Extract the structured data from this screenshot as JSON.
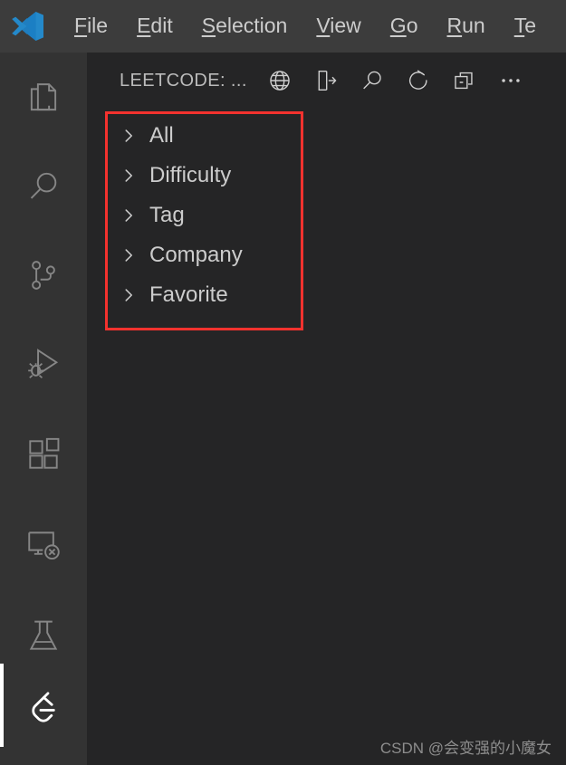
{
  "window": {
    "app_logo_icon": "vscode-logo-icon",
    "titlebar_bg": "#3c3c3c"
  },
  "menubar": {
    "items": [
      {
        "label": "File",
        "mnemonic": "F",
        "rest": "ile"
      },
      {
        "label": "Edit",
        "mnemonic": "E",
        "rest": "dit"
      },
      {
        "label": "Selection",
        "mnemonic": "S",
        "rest": "election"
      },
      {
        "label": "View",
        "mnemonic": "V",
        "rest": "iew"
      },
      {
        "label": "Go",
        "mnemonic": "G",
        "rest": "o"
      },
      {
        "label": "Run",
        "mnemonic": "R",
        "rest": "un"
      },
      {
        "label": "Te",
        "mnemonic": "T",
        "rest": "e"
      }
    ]
  },
  "activitybar": {
    "bg": "#333333",
    "active_indicator_color": "#ffffff",
    "items": [
      {
        "name": "explorer",
        "icon": "files-icon",
        "title": "Explorer",
        "active": false
      },
      {
        "name": "search",
        "icon": "search-icon",
        "title": "Search",
        "active": false
      },
      {
        "name": "source-control",
        "icon": "source-control-icon",
        "title": "Source Control",
        "active": false
      },
      {
        "name": "run-and-debug",
        "icon": "run-and-debug-icon",
        "title": "Run and Debug",
        "active": false
      },
      {
        "name": "extensions",
        "icon": "extensions-icon",
        "title": "Extensions",
        "active": false
      },
      {
        "name": "remote-explorer",
        "icon": "remote-explorer-icon",
        "title": "Remote Explorer",
        "active": false
      },
      {
        "name": "testing",
        "icon": "beaker-icon",
        "title": "Testing",
        "active": false
      },
      {
        "name": "leetcode",
        "icon": "leetcode-icon",
        "title": "LeetCode",
        "active": true
      }
    ]
  },
  "sidebar": {
    "bg": "#252526",
    "header": {
      "title": "LEETCODE: ...",
      "actions": [
        {
          "name": "switch-endpoint",
          "icon": "globe-icon",
          "label": "Switch Endpoint"
        },
        {
          "name": "sign-out",
          "icon": "sign-out-icon",
          "label": "Sign Out"
        },
        {
          "name": "search-problem",
          "icon": "search-icon",
          "label": "Search Problem"
        },
        {
          "name": "refresh",
          "icon": "refresh-icon",
          "label": "Refresh"
        },
        {
          "name": "collapse-all",
          "icon": "collapse-all-icon",
          "label": "Collapse All"
        },
        {
          "name": "more-actions",
          "icon": "ellipsis-icon",
          "label": "Views and More Actions..."
        }
      ]
    },
    "tree": {
      "chevron_icon": "chevron-right-icon",
      "items": [
        {
          "label": "All",
          "expanded": false
        },
        {
          "label": "Difficulty",
          "expanded": false
        },
        {
          "label": "Tag",
          "expanded": false
        },
        {
          "label": "Company",
          "expanded": false
        },
        {
          "label": "Favorite",
          "expanded": false
        }
      ]
    }
  },
  "annotation": {
    "color": "#f4322e",
    "shape": "rectangle"
  },
  "watermark": {
    "text": "CSDN @会变强的小魔女"
  }
}
